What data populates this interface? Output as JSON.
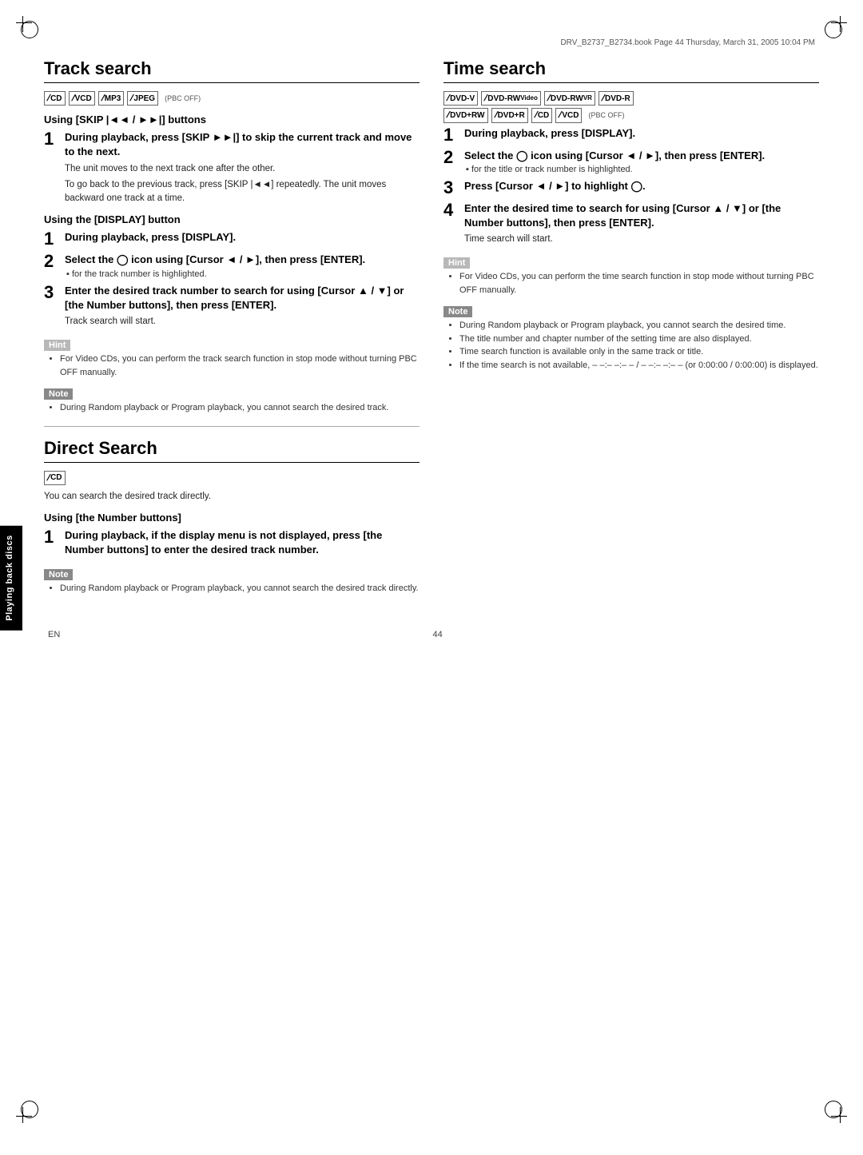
{
  "page": {
    "header_text": "DRV_B2737_B2734.book  Page 44  Thursday, March 31, 2005  10:04 PM",
    "footer_left": "EN",
    "footer_center": "44",
    "sidebar_label": "Playing back discs"
  },
  "track_search": {
    "title": "Track search",
    "format_icons": [
      "CD",
      "VCD",
      "MP3",
      "JPEG"
    ],
    "pbc_off": "(PBC OFF)",
    "using_skip_heading": "Using [SKIP |◄◄ / ►►|] buttons",
    "step1_bold": "During playback, press [SKIP ►►|] to skip the current track and move to the next.",
    "step1_note1": "The unit moves to the next track one after the other.",
    "step1_note2": "To go back to the previous track, press [SKIP |◄◄] repeatedly. The unit moves backward one track at a time.",
    "using_display_heading": "Using the [DISPLAY] button",
    "d_step1_bold": "During playback, press [DISPLAY].",
    "d_step2_bold": "Select the  icon using [Cursor ◄ / ►], then press [ENTER].",
    "d_step2_note": "for the track number is highlighted.",
    "d_step3_bold": "Enter the desired track number to search for using [Cursor ▲ / ▼] or [the Number buttons], then press [ENTER].",
    "d_step3_note": "Track search will start.",
    "hint_label": "Hint",
    "hint_text": "For Video CDs, you can perform the track search function in stop mode without turning PBC OFF manually.",
    "note_label": "Note",
    "note_text": "During Random playback or Program playback, you cannot search the desired track."
  },
  "direct_search": {
    "title": "Direct Search",
    "format_icons": [
      "CD"
    ],
    "desc": "You can search the desired track directly.",
    "using_number_heading": "Using [the Number buttons]",
    "step1_bold": "During playback, if the display menu is not displayed, press [the Number buttons] to enter the desired track number.",
    "note_label": "Note",
    "note_text": "During Random playback or Program playback, you cannot search the desired track directly."
  },
  "time_search": {
    "title": "Time search",
    "format_row1": [
      "DVD-V",
      "DVD-RW (Video)",
      "DVD-RW (VR)",
      "DVD-R"
    ],
    "format_row2": [
      "DVD+RW",
      "DVD+R",
      "CD",
      "VCD"
    ],
    "pbc_off": "(PBC OFF)",
    "step1_bold": "During playback, press [DISPLAY].",
    "step2_bold": "Select the  icon using [Cursor ◄ / ►], then press [ENTER].",
    "step2_note": "for the title or track number is highlighted.",
    "step3_bold": "Press [Cursor ◄ / ►] to highlight .",
    "step4_bold": "Enter the desired time to search for using [Cursor ▲ / ▼] or [the Number buttons], then press [ENTER].",
    "step4_note": "Time search will start.",
    "hint_label": "Hint",
    "hint_text": "For Video CDs, you can perform the time search function in stop mode without turning PBC OFF manually.",
    "note_label": "Note",
    "note_items": [
      "During Random playback or Program playback, you cannot search the desired time.",
      "The title number and chapter number of the setting time are also displayed.",
      "Time search function is available only in the same track or title.",
      "If the time search is not available, – –:– –:– – / – –:– –:– – (or 0:00:00 / 0:00:00) is displayed."
    ]
  }
}
